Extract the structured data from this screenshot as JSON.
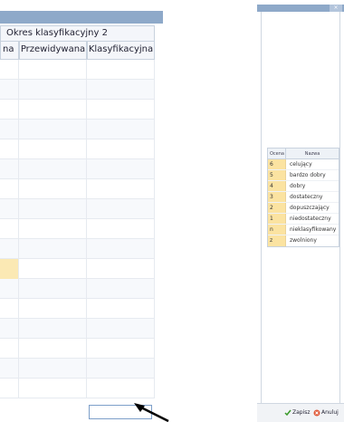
{
  "grid": {
    "period_header": "Okres klasyfikacyjny 2",
    "columns": [
      "na",
      "Przewidywana",
      "Klasyfikacyjna"
    ],
    "row_count": 17,
    "highlight_row": 10
  },
  "popup": {
    "close_glyph": "×",
    "table": {
      "headers": [
        "Ocena",
        "Nazwa"
      ],
      "rows": [
        {
          "grade": "6",
          "name": "celujący"
        },
        {
          "grade": "5",
          "name": "bardzo dobry"
        },
        {
          "grade": "4",
          "name": "dobry"
        },
        {
          "grade": "3",
          "name": "dostateczny"
        },
        {
          "grade": "2",
          "name": "dopuszczający"
        },
        {
          "grade": "1",
          "name": "niedostateczny"
        },
        {
          "grade": "n",
          "name": "nieklasyfikowany"
        },
        {
          "grade": "z",
          "name": "zwolniony"
        }
      ]
    },
    "buttons": {
      "save": "Zapisz",
      "cancel": "Anuluj"
    }
  },
  "colors": {
    "accent": "#8ea9c9",
    "highlight": "#fbe3a1"
  }
}
